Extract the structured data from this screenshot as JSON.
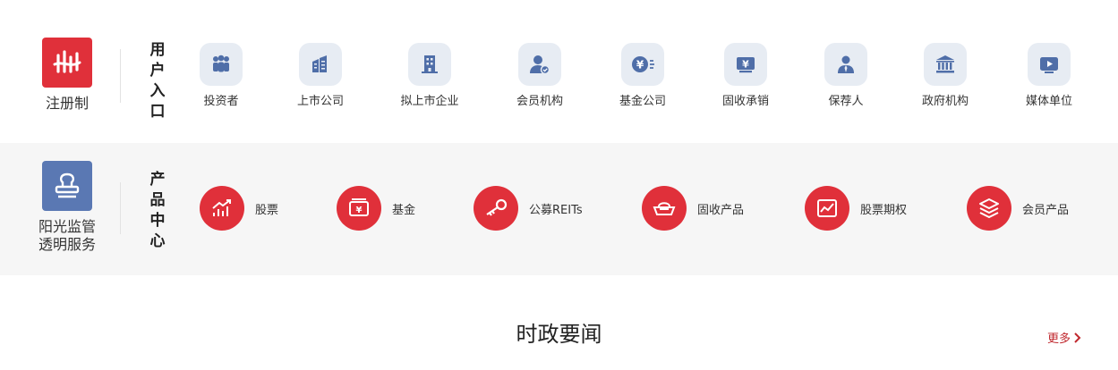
{
  "user_section": {
    "brand_label": "注册制",
    "heading": "用户入口",
    "entries": [
      {
        "label": "投资者",
        "icon": "investors-icon"
      },
      {
        "label": "上市公司",
        "icon": "listed-company-icon"
      },
      {
        "label": "拟上市企业",
        "icon": "pre-ipo-company-icon"
      },
      {
        "label": "会员机构",
        "icon": "member-institution-icon"
      },
      {
        "label": "基金公司",
        "icon": "fund-company-icon"
      },
      {
        "label": "固收承销",
        "icon": "fixed-income-underwriting-icon"
      },
      {
        "label": "保荐人",
        "icon": "sponsor-icon"
      },
      {
        "label": "政府机构",
        "icon": "government-icon"
      },
      {
        "label": "媒体单位",
        "icon": "media-icon"
      }
    ]
  },
  "product_section": {
    "brand_label_line1": "阳光监管",
    "brand_label_line2": "透明服务",
    "heading": "产品中心",
    "products": [
      {
        "label": "股票",
        "icon": "stock-chart-icon"
      },
      {
        "label": "基金",
        "icon": "fund-wallet-icon"
      },
      {
        "label": "公募REITs",
        "icon": "key-icon"
      },
      {
        "label": "固收产品",
        "icon": "ingot-icon"
      },
      {
        "label": "股票期权",
        "icon": "option-chart-icon"
      },
      {
        "label": "会员产品",
        "icon": "layers-icon"
      }
    ]
  },
  "news": {
    "title": "时政要闻",
    "more_label": "更多"
  },
  "colors": {
    "brand_red": "#e0303a",
    "brand_blue": "#5a78b3",
    "icon_blue": "#4f6ea8",
    "icon_bg": "#e7ecf3",
    "section_bg": "#f6f6f6",
    "more_red": "#c0282e"
  }
}
